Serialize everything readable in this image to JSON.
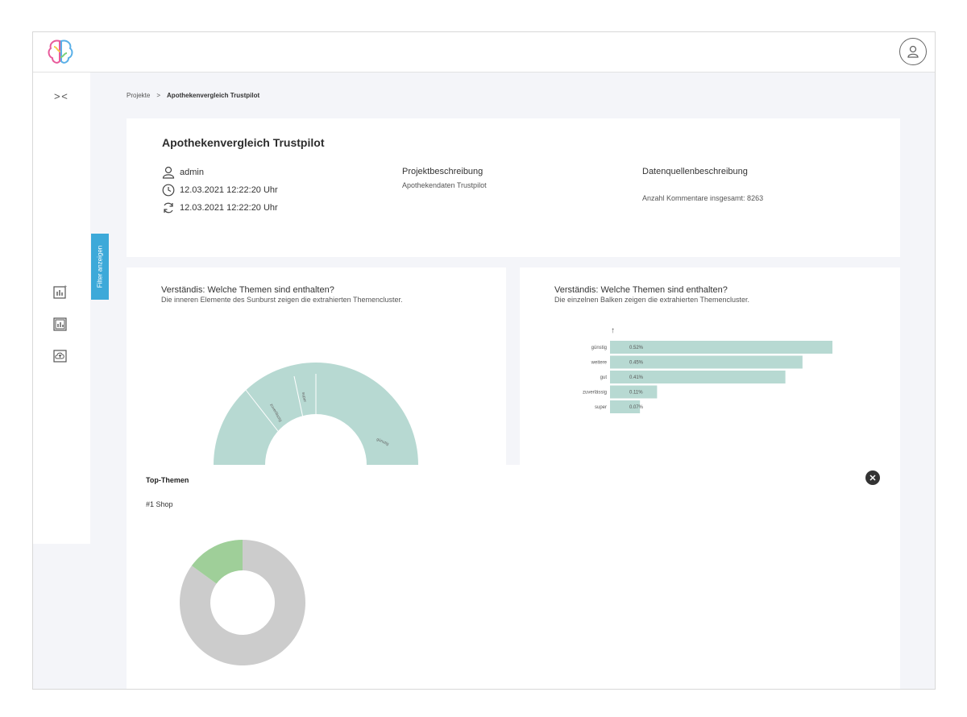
{
  "breadcrumb": {
    "parent": "Projekte",
    "separator": ">",
    "current": "Apothekenvergleich Trustpilot"
  },
  "project": {
    "title": "Apothekenvergleich Trustpilot",
    "user": "admin",
    "created": "12.03.2021 12:22:20 Uhr",
    "updated": "12.03.2021 12:22:20 Uhr",
    "description_heading": "Projektbeschreibung",
    "description": "Apothekendaten Trustpilot",
    "source_heading": "Datenquellenbeschreibung",
    "source_text": "Anzahl Kommentare insgesamt: 8263"
  },
  "sidebar": {
    "filter_label": "Filter anzeigen",
    "collapse_label": "> <"
  },
  "colors": {
    "accent": "#3da9d9",
    "chart": "#b7d9d2",
    "donut_grey": "#cccccc",
    "donut_green": "#9fcf99"
  },
  "charts": {
    "left": {
      "title": "Verständis: Welche Themen sind enthalten?",
      "subtitle": "Die inneren Elemente des Sunburst zeigen die extrahierten Themencluster.",
      "segments": [
        "günstig",
        "zuverlässig",
        "super"
      ]
    },
    "right": {
      "title": "Verständis: Welche Themen sind enthalten?",
      "subtitle": "Die einzelnen Balken zeigen die extrahierten Themencluster.",
      "arrow": "↑"
    }
  },
  "chart_data": [
    {
      "type": "bar",
      "orientation": "horizontal",
      "categories": [
        "günstig",
        "weitere",
        "gut",
        "zuverlässig",
        "super"
      ],
      "values": [
        0.52,
        0.45,
        0.41,
        0.11,
        0.07
      ],
      "value_labels": [
        "0.52%",
        "0.45%",
        "0.41%",
        "0.11%",
        "0.07%"
      ]
    },
    {
      "type": "pie",
      "labels": [
        "",
        ""
      ],
      "values": [
        85,
        15
      ]
    }
  ],
  "overlay": {
    "title": "Top-Themen",
    "item": "#1 Shop"
  }
}
